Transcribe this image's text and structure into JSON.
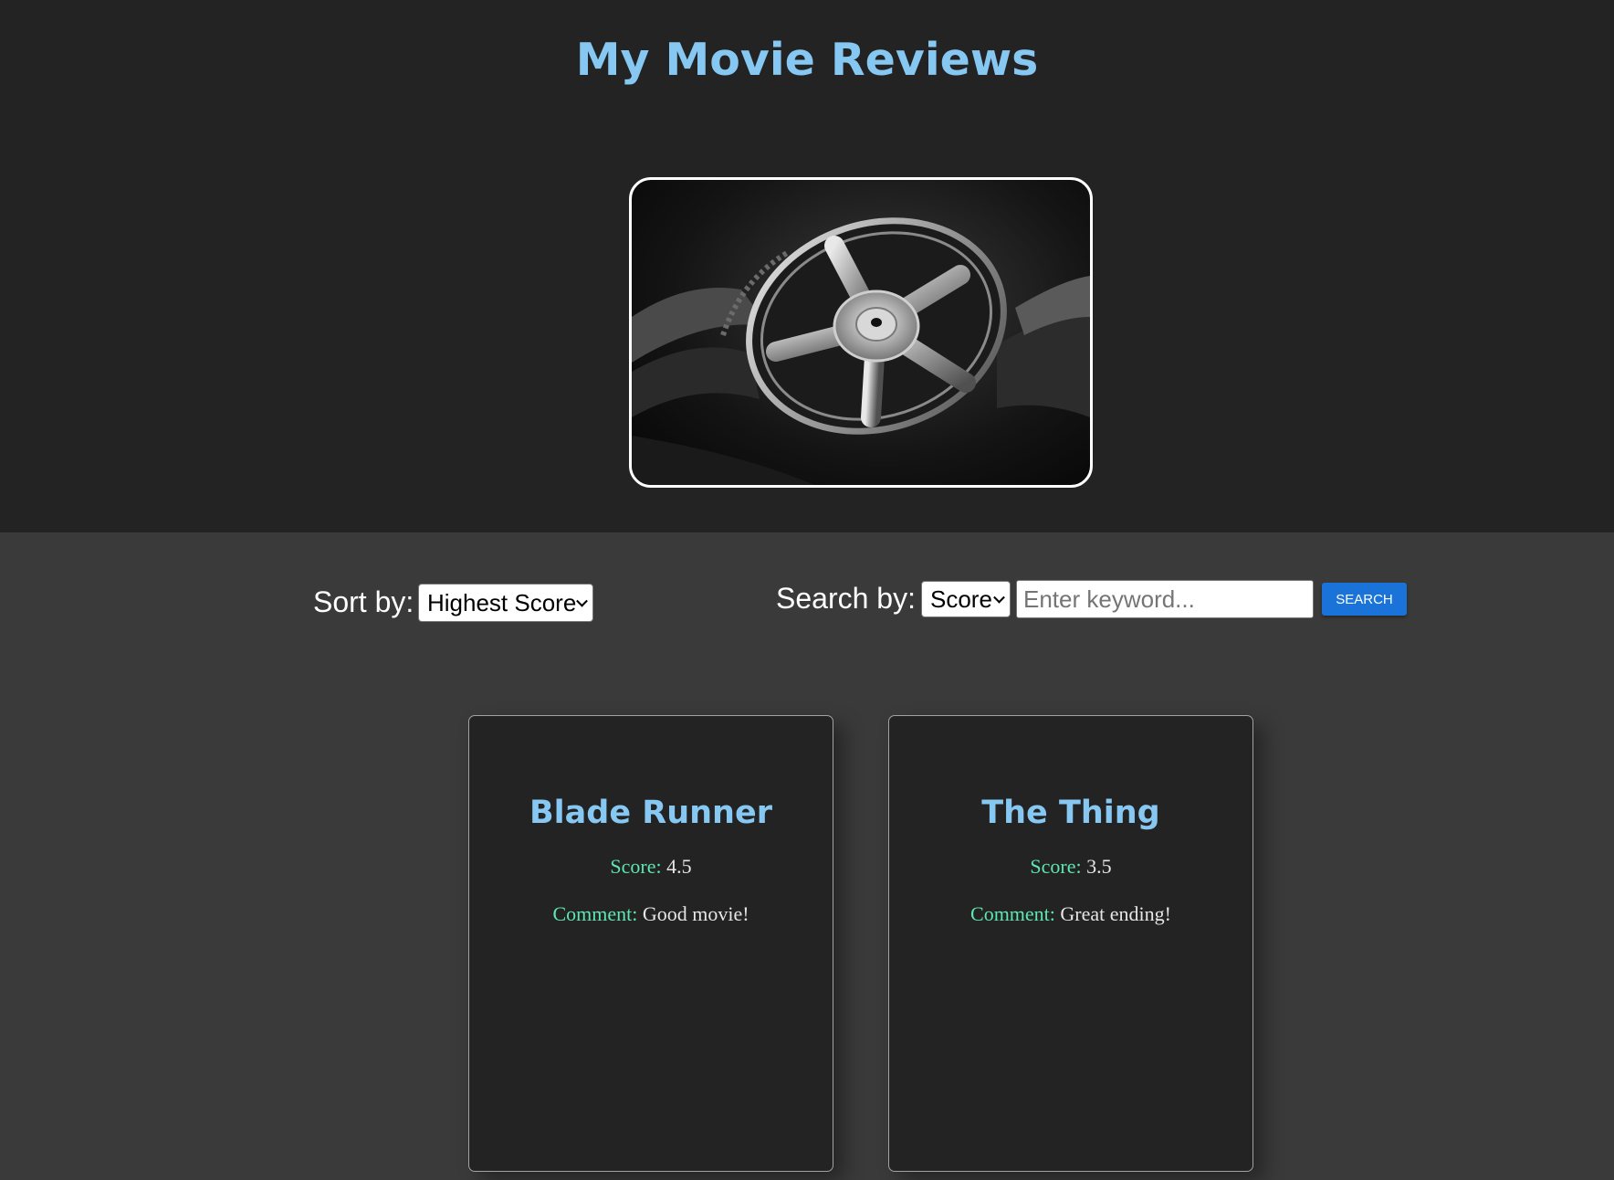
{
  "page": {
    "title": "My Movie Reviews"
  },
  "hero": {
    "image": "film-reel-photo"
  },
  "controls": {
    "sort_label": "Sort by:",
    "sort_selected": "Highest Score",
    "search_label": "Search by:",
    "search_field_selected": "Score",
    "search_placeholder": "Enter keyword...",
    "search_value": "",
    "search_button": "SEARCH"
  },
  "reviews": [
    {
      "title": "Blade Runner",
      "score_label": "Score:",
      "score": "4.5",
      "comment_label": "Comment:",
      "comment": "Good movie!"
    },
    {
      "title": "The Thing",
      "score_label": "Score:",
      "score": "3.5",
      "comment_label": "Comment:",
      "comment": "Great ending!"
    }
  ],
  "colors": {
    "accent": "#86c8f2",
    "label": "#5ee6b3",
    "button": "#1a73d9",
    "header_bg": "#232323",
    "page_bg": "#3a3a3a"
  }
}
